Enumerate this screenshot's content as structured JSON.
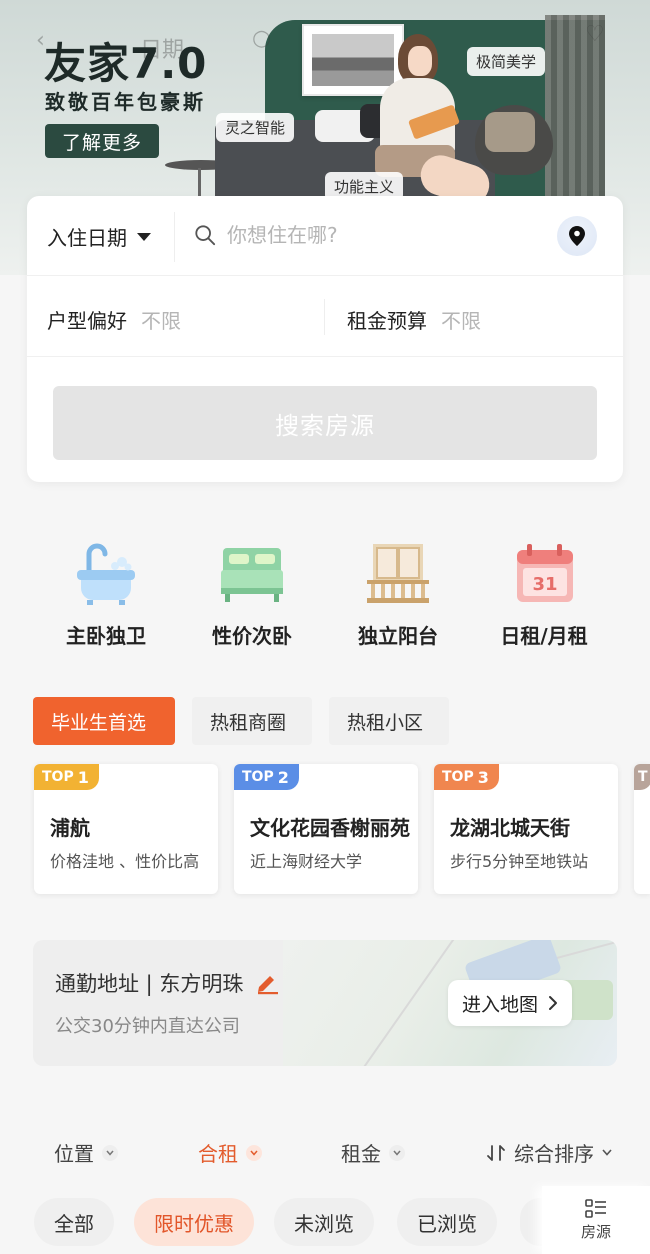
{
  "banner": {
    "ghost_date": "日期",
    "title": "友家7.0",
    "subtitle": "致敬百年包豪斯",
    "cta_label": "了解更多",
    "tags": [
      "灵之智能",
      "极简美学",
      "功能主义"
    ]
  },
  "search_card": {
    "date_label": "入住日期",
    "search_placeholder": "你想住在哪?",
    "layout_pref_label": "户型偏好",
    "layout_pref_value": "不限",
    "budget_label": "租金预算",
    "budget_value": "不限",
    "search_button": "搜索房源"
  },
  "categories": [
    {
      "label": "主卧独卫",
      "icon": "bathtub-icon"
    },
    {
      "label": "性价次卧",
      "icon": "bed-icon"
    },
    {
      "label": "独立阳台",
      "icon": "balcony-icon"
    },
    {
      "label": "日租/月租",
      "icon": "calendar-icon"
    }
  ],
  "tabs": [
    {
      "label": "毕业生首选",
      "active": true
    },
    {
      "label": "热租商圈",
      "active": false
    },
    {
      "label": "热租小区",
      "active": false
    }
  ],
  "top_cards": [
    {
      "badge": "TOP",
      "rank": "1",
      "name": "浦航",
      "desc": "价格洼地 、性价比高",
      "color": "#f2b233"
    },
    {
      "badge": "TOP",
      "rank": "2",
      "name": "文化花园香榭丽苑",
      "desc": "近上海财经大学",
      "color": "#5b8ee6"
    },
    {
      "badge": "TOP",
      "rank": "3",
      "name": "龙湖北城天街",
      "desc": "步行5分钟至地铁站",
      "color": "#f0864f"
    },
    {
      "badge": "T",
      "rank": "",
      "name": "",
      "desc": "",
      "color": "#b8a49a"
    }
  ],
  "commute": {
    "title": "通勤地址 | 东方明珠",
    "subtitle": "公交30分钟内直达公司",
    "map_button": "进入地图"
  },
  "filters": [
    {
      "label": "位置",
      "active": false
    },
    {
      "label": "合租",
      "active": true
    },
    {
      "label": "租金",
      "active": false
    },
    {
      "label": "综合排序",
      "active": false
    }
  ],
  "chips": [
    {
      "label": "全部",
      "active": false
    },
    {
      "label": "限时优惠",
      "active": true
    },
    {
      "label": "未浏览",
      "active": false
    },
    {
      "label": "已浏览",
      "active": false
    }
  ],
  "fab": {
    "label": "房源",
    "icon": "list-icon"
  },
  "colors": {
    "accent": "#f0632e",
    "brand_dark": "#2b4a40"
  }
}
